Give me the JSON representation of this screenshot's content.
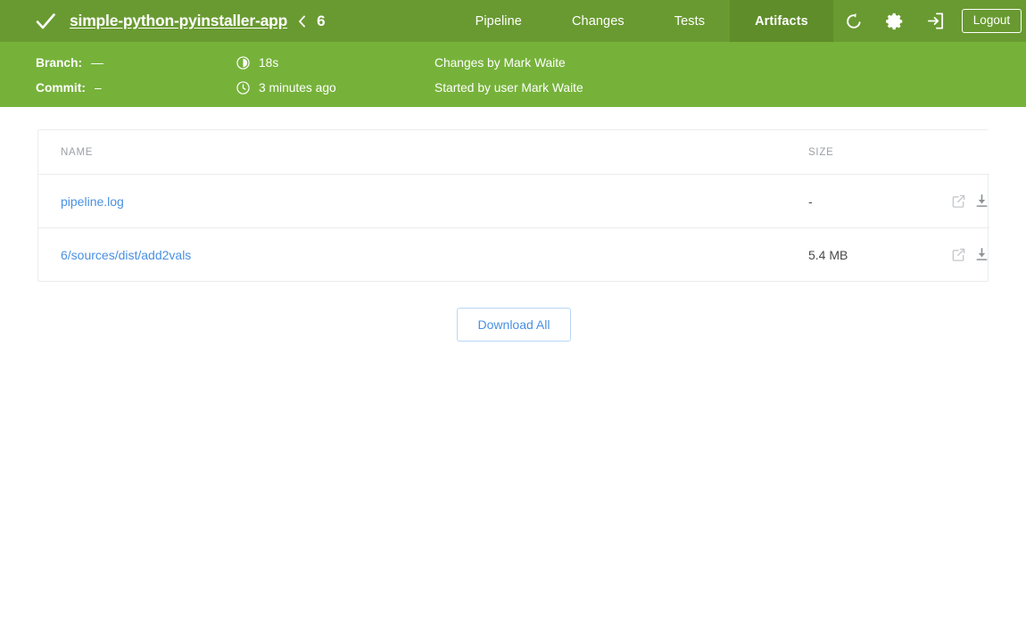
{
  "header": {
    "status_icon": "check-icon",
    "status": "SUCCESS",
    "pipeline_name": "simple-python-pyinstaller-app",
    "separator_icon": "chevron-left-icon",
    "build_number": "6",
    "tabs": [
      {
        "label": "Pipeline",
        "active": false
      },
      {
        "label": "Changes",
        "active": false
      },
      {
        "label": "Tests",
        "active": false
      },
      {
        "label": "Artifacts",
        "active": true
      }
    ],
    "actions": {
      "rerun_icon": "replay-icon",
      "settings_icon": "gear-icon",
      "login_icon": "login-arrow-icon",
      "logout_label": "Logout",
      "close_icon": "close-icon"
    },
    "bg_color": "#699a31",
    "active_tab_color": "#5f8d2a"
  },
  "info": {
    "branch_label": "Branch:",
    "branch_value": "—",
    "commit_label": "Commit:",
    "commit_value": "–",
    "duration_icon": "duration-icon",
    "duration_value": "18s",
    "time_icon": "clock-icon",
    "time_value": "3 minutes ago",
    "changes_by": "Changes by Mark Waite",
    "started_by": "Started by user Mark Waite",
    "bg_color": "#76b23a"
  },
  "artifacts_table": {
    "columns": [
      "NAME",
      "SIZE",
      ""
    ],
    "rows": [
      {
        "name": "pipeline.log",
        "size": "-",
        "open_icon": "external-link-icon",
        "download_icon": "download-icon"
      },
      {
        "name": "6/sources/dist/add2vals",
        "size": "5.4 MB",
        "open_icon": "external-link-icon",
        "download_icon": "download-icon"
      }
    ]
  },
  "footer": {
    "download_all_label": "Download All",
    "link_color": "#4a90e2"
  }
}
